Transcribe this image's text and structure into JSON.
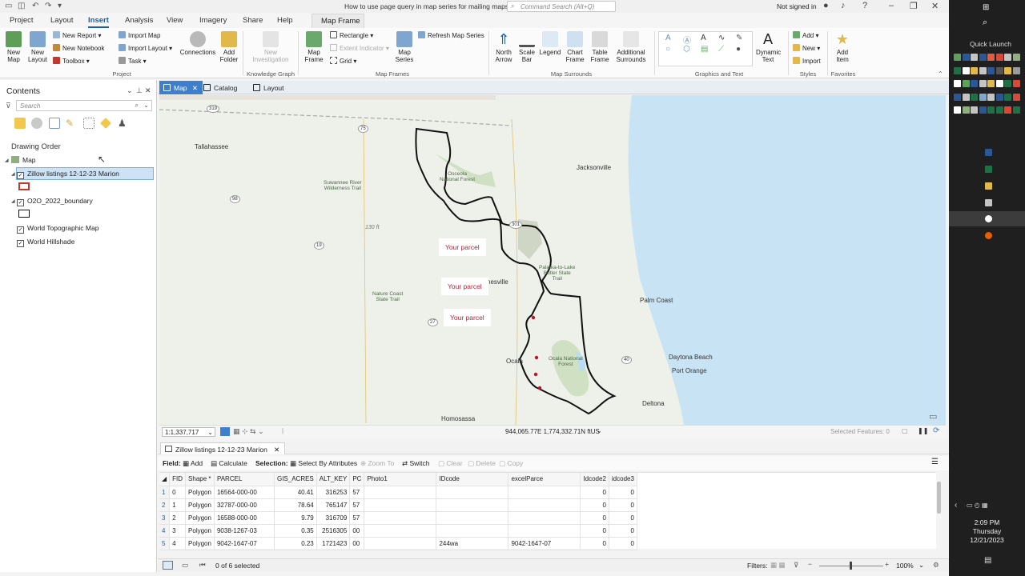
{
  "window": {
    "doc_title": "How to use page query in map series for mailing maps",
    "search_placeholder": "Command Search (Alt+Q)",
    "sign_in": "Not signed in"
  },
  "ribbon_tabs": [
    "Project",
    "Layout",
    "Insert",
    "Analysis",
    "View",
    "Imagery",
    "Share",
    "Help"
  ],
  "active_tab": "Insert",
  "contextual_tab": "Map Frame",
  "ribbon": {
    "new_map": "New\nMap",
    "new_layout": "New\nLayout",
    "new_report": "New Report",
    "new_notebook": "New Notebook",
    "toolbox": "Toolbox",
    "import_map": "Import Map",
    "import_layout": "Import Layout",
    "task": "Task",
    "connections": "Connections",
    "add_folder": "Add\nFolder",
    "new_investigation": "New\nInvestigation",
    "map_frame": "Map\nFrame",
    "rectangle": "Rectangle",
    "extent_indicator": "Extent Indicator",
    "grid": "Grid",
    "map_series": "Map\nSeries",
    "refresh_map_series": "Refresh Map Series",
    "north_arrow": "North\nArrow",
    "scale_bar": "Scale\nBar",
    "legend": "Legend",
    "chart_frame": "Chart\nFrame",
    "table_frame": "Table\nFrame",
    "additional_surrounds": "Additional\nSurrounds",
    "dynamic_text": "Dynamic\nText",
    "add": "Add",
    "new": "New",
    "import": "Import",
    "add_item": "Add\nItem",
    "groups": {
      "project": "Project",
      "knowledge_graph": "Knowledge Graph",
      "map_frames": "Map Frames",
      "map_surrounds": "Map Surrounds",
      "graphics_text": "Graphics and Text",
      "styles": "Styles",
      "favorites": "Favorites"
    }
  },
  "contents": {
    "title": "Contents",
    "search_placeholder": "Search",
    "drawing_order": "Drawing Order",
    "map": "Map",
    "layers": [
      {
        "name": "Zillow listings 12-12-23 Marion",
        "checked": true
      },
      {
        "name": "O2O_2022_boundary",
        "checked": true
      },
      {
        "name": "World Topographic Map",
        "checked": true
      },
      {
        "name": "World Hillshade",
        "checked": true
      }
    ]
  },
  "views": [
    "Map",
    "Catalog",
    "Layout"
  ],
  "active_view": "Map",
  "map": {
    "labels": {
      "tallahassee": "Tallahassee",
      "jacksonville": "Jacksonville",
      "palm_coast": "Palm Coast",
      "daytona": "Daytona Beach",
      "port_orange": "Port Orange",
      "deltona": "Deltona",
      "homosassa": "Homosassa",
      "ocala": "Ocala",
      "gainesville": "nesville",
      "osceola": "Osceola\nNational Forest",
      "suwannee": "Suwannee River\nWilderness Trail",
      "nature_coast": "Nature Coast\nState Trail",
      "ocala_nf": "Ocala National\nForest",
      "palatka": "Palatka-to-Lake\nButler State\nTrail",
      "elevation": "130 ft"
    },
    "routes": [
      "319",
      "75",
      "98",
      "19",
      "27",
      "301",
      "40"
    ],
    "callouts": [
      "Your parcel",
      "Your parcel",
      "Your parcel"
    ],
    "scale": "1:1,337,717",
    "coordinates": "944,065.77E 1,774,332.71N ftUS",
    "selected_features": "Selected Features: 0"
  },
  "attribute_table": {
    "tab": "Zillow listings 12-12-23 Marion",
    "toolbar": {
      "field": "Field:",
      "add": "Add",
      "calculate": "Calculate",
      "selection": "Selection:",
      "select_by_attributes": "Select By Attributes",
      "zoom_to": "Zoom To",
      "switch": "Switch",
      "clear": "Clear",
      "delete": "Delete",
      "copy": "Copy"
    },
    "columns": [
      "FID",
      "Shape *",
      "PARCEL",
      "GIS_ACRES",
      "ALT_KEY",
      "PC",
      "Photo1",
      "IDcode",
      "excelParce",
      "Idcode2",
      "idcode3"
    ],
    "rows": [
      [
        "1",
        "0",
        "Polygon",
        "16564-000-00",
        "40.41",
        "316253",
        "57",
        "",
        "",
        "",
        "0",
        "0"
      ],
      [
        "2",
        "1",
        "Polygon",
        "32787-000-00",
        "78.64",
        "765147",
        "57",
        "",
        "",
        "",
        "0",
        "0"
      ],
      [
        "3",
        "2",
        "Polygon",
        "16588-000-00",
        "9.79",
        "316709",
        "57",
        "",
        "",
        "",
        "0",
        "0"
      ],
      [
        "4",
        "3",
        "Polygon",
        "9038-1267-03",
        "0.35",
        "2516305",
        "00",
        "",
        "",
        "",
        "0",
        "0"
      ],
      [
        "5",
        "4",
        "Polygon",
        "9042-1647-07",
        "0.23",
        "1721423",
        "00",
        "",
        "244wa",
        "9042-1647-07",
        "0",
        "0"
      ]
    ],
    "selected_count": "0 of 6 selected",
    "filters": "Filters:",
    "zoom": "100%"
  },
  "taskbar": {
    "quick_launch": "Quick Launch",
    "time": "2:09 PM",
    "day": "Thursday",
    "date": "12/21/2023"
  },
  "colors": {
    "accent": "#1b5fb0",
    "active_view_tab": "#3d7fcc",
    "parcel_text": "#b0263a",
    "water": "#c8e4f4",
    "land": "#eef0ea"
  }
}
